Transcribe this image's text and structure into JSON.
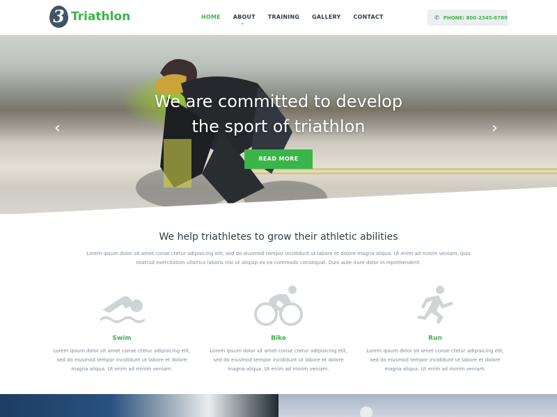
{
  "brand": {
    "badge": "3",
    "name": "Triathlon"
  },
  "nav": {
    "items": [
      {
        "label": "HOME",
        "active": true
      },
      {
        "label": "ABOUT",
        "has_dropdown": true
      },
      {
        "label": "TRAINING"
      },
      {
        "label": "GALLERY"
      },
      {
        "label": "CONTACT"
      }
    ],
    "caret": "⌄"
  },
  "phone": {
    "icon": "phone-icon",
    "label": "PHONE: 800-2345-6789"
  },
  "hero": {
    "title_line1": "We are committed to develop",
    "title_line2": "the sport of triathlon",
    "button": "READ MORE",
    "prev": "‹",
    "next": "›"
  },
  "intro": {
    "title": "We help triathletes to grow their athletic abilities",
    "text": "Lorem ipsum dolor sit amet conse ctetur adipisicing elit, sed do eiusmod tempor incididunt ut labore et dolore magna aliqua. Ut enim ad minim veniam, quis nostrud exercitation ullamco laboris nisi ut aliquip ex ea commodo consequat. Duis aute irure dolor in reprehenderit."
  },
  "features": [
    {
      "icon": "swimmer-icon",
      "title": "Swim",
      "text": "Lorem ipsum dolor sit amet conse ctetur adipisicing elit, sed do eiusmod tempor incididunt ut labore et dolore magna aliqua. Ut enim ad minim veniam."
    },
    {
      "icon": "cyclist-icon",
      "title": "Bike",
      "text": "Lorem ipsum dolor sit amet conse ctetur adipisicing elit, sed do eiusmod tempor incididunt ut labore et dolore magna aliqua. Ut enim ad minim veniam."
    },
    {
      "icon": "runner-icon",
      "title": "Run",
      "text": "Lorem ipsum dolor sit amet conse ctetur adipisicing elit, sed do eiusmod tempor incididunt ut labore et dolore magna aliqua. Ut enim ad minim veniam."
    }
  ],
  "colors": {
    "accent": "#3ab54a",
    "dark": "#2c3e4c",
    "muted": "#7b8a93",
    "badge": "#3f5566"
  }
}
